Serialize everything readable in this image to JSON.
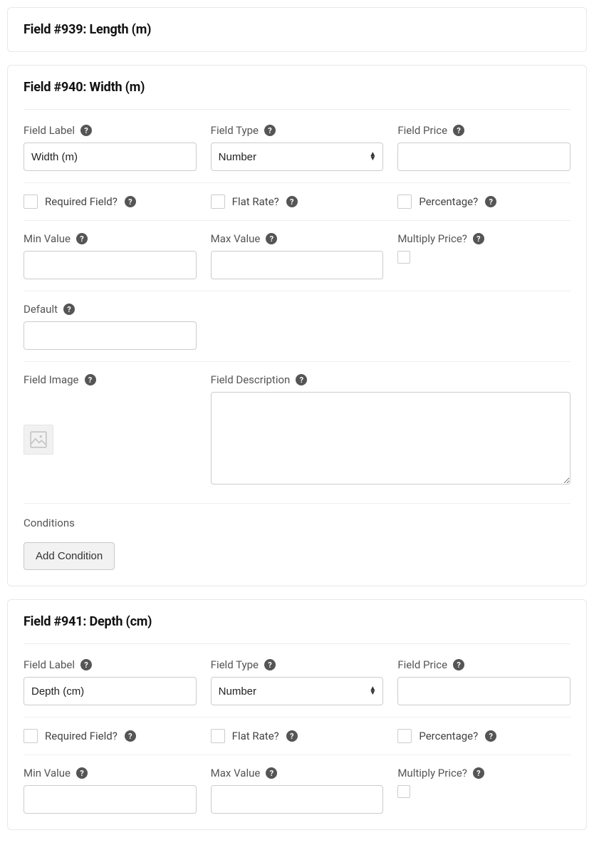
{
  "fields": [
    {
      "header": "Field #939: Length (m)",
      "expanded": false
    },
    {
      "header": "Field #940: Width (m)",
      "expanded": true,
      "labels": {
        "field_label": "Field Label",
        "field_type": "Field Type",
        "field_price": "Field Price",
        "required": "Required Field?",
        "flat_rate": "Flat Rate?",
        "percentage": "Percentage?",
        "min_value": "Min Value",
        "max_value": "Max Value",
        "multiply_price": "Multiply Price?",
        "default": "Default",
        "field_image": "Field Image",
        "field_desc": "Field Description",
        "conditions": "Conditions",
        "add_condition": "Add Condition"
      },
      "values": {
        "field_label": "Width (m)",
        "field_type": "Number",
        "field_price": "",
        "required": false,
        "flat_rate": false,
        "percentage": false,
        "min_value": "",
        "max_value": "",
        "multiply_price": false,
        "default": "",
        "field_desc": ""
      }
    },
    {
      "header": "Field #941: Depth (cm)",
      "expanded": true,
      "labels": {
        "field_label": "Field Label",
        "field_type": "Field Type",
        "field_price": "Field Price",
        "required": "Required Field?",
        "flat_rate": "Flat Rate?",
        "percentage": "Percentage?",
        "min_value": "Min Value",
        "max_value": "Max Value",
        "multiply_price": "Multiply Price?"
      },
      "values": {
        "field_label": "Depth (cm)",
        "field_type": "Number",
        "field_price": "",
        "required": false,
        "flat_rate": false,
        "percentage": false,
        "min_value": "",
        "max_value": "",
        "multiply_price": false
      }
    }
  ],
  "help_glyph": "?"
}
